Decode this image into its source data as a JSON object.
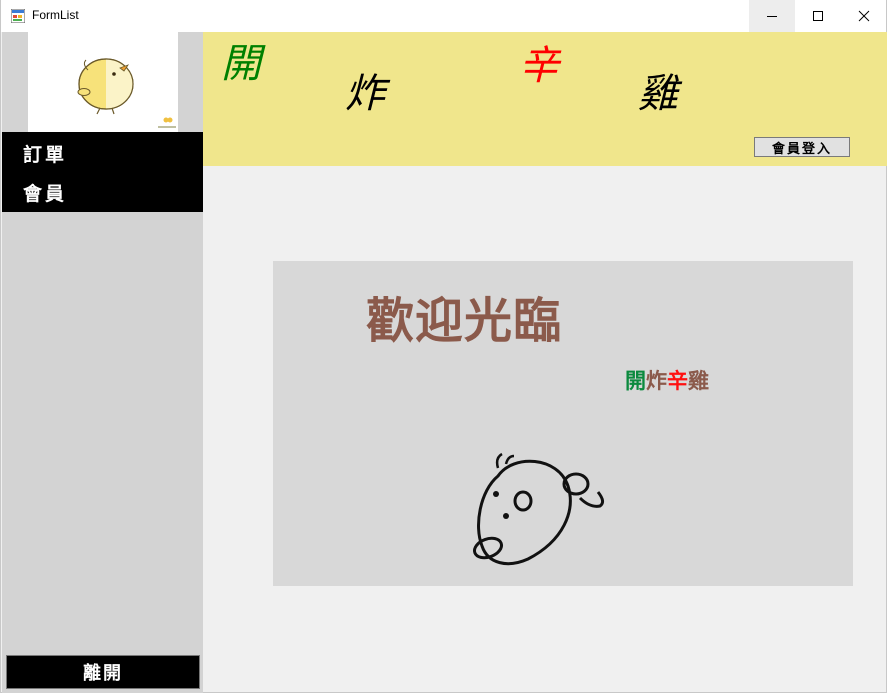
{
  "window": {
    "title": "FormList",
    "controls": {
      "minimize_icon": "minimize-icon",
      "maximize_icon": "maximize-icon",
      "close_icon": "close-icon"
    }
  },
  "sidebar": {
    "menu_items": [
      {
        "label": "訂單"
      },
      {
        "label": "會員"
      }
    ],
    "exit_label": "離開"
  },
  "header": {
    "chars": [
      {
        "text": "開",
        "color": "#008000"
      },
      {
        "text": "炸",
        "color": "#000000"
      },
      {
        "text": "辛",
        "color": "#ff0000"
      },
      {
        "text": "雞",
        "color": "#000000"
      }
    ],
    "login_label": "會員登入",
    "background": "#f0e68c"
  },
  "main": {
    "welcome_title": "歡迎光臨",
    "brand": [
      {
        "text": "開",
        "color": "#0b8a3e"
      },
      {
        "text": "炸",
        "color": "#8b5a4b"
      },
      {
        "text": "辛",
        "color": "#ff1010"
      },
      {
        "text": "雞",
        "color": "#8b5a4b"
      }
    ]
  }
}
